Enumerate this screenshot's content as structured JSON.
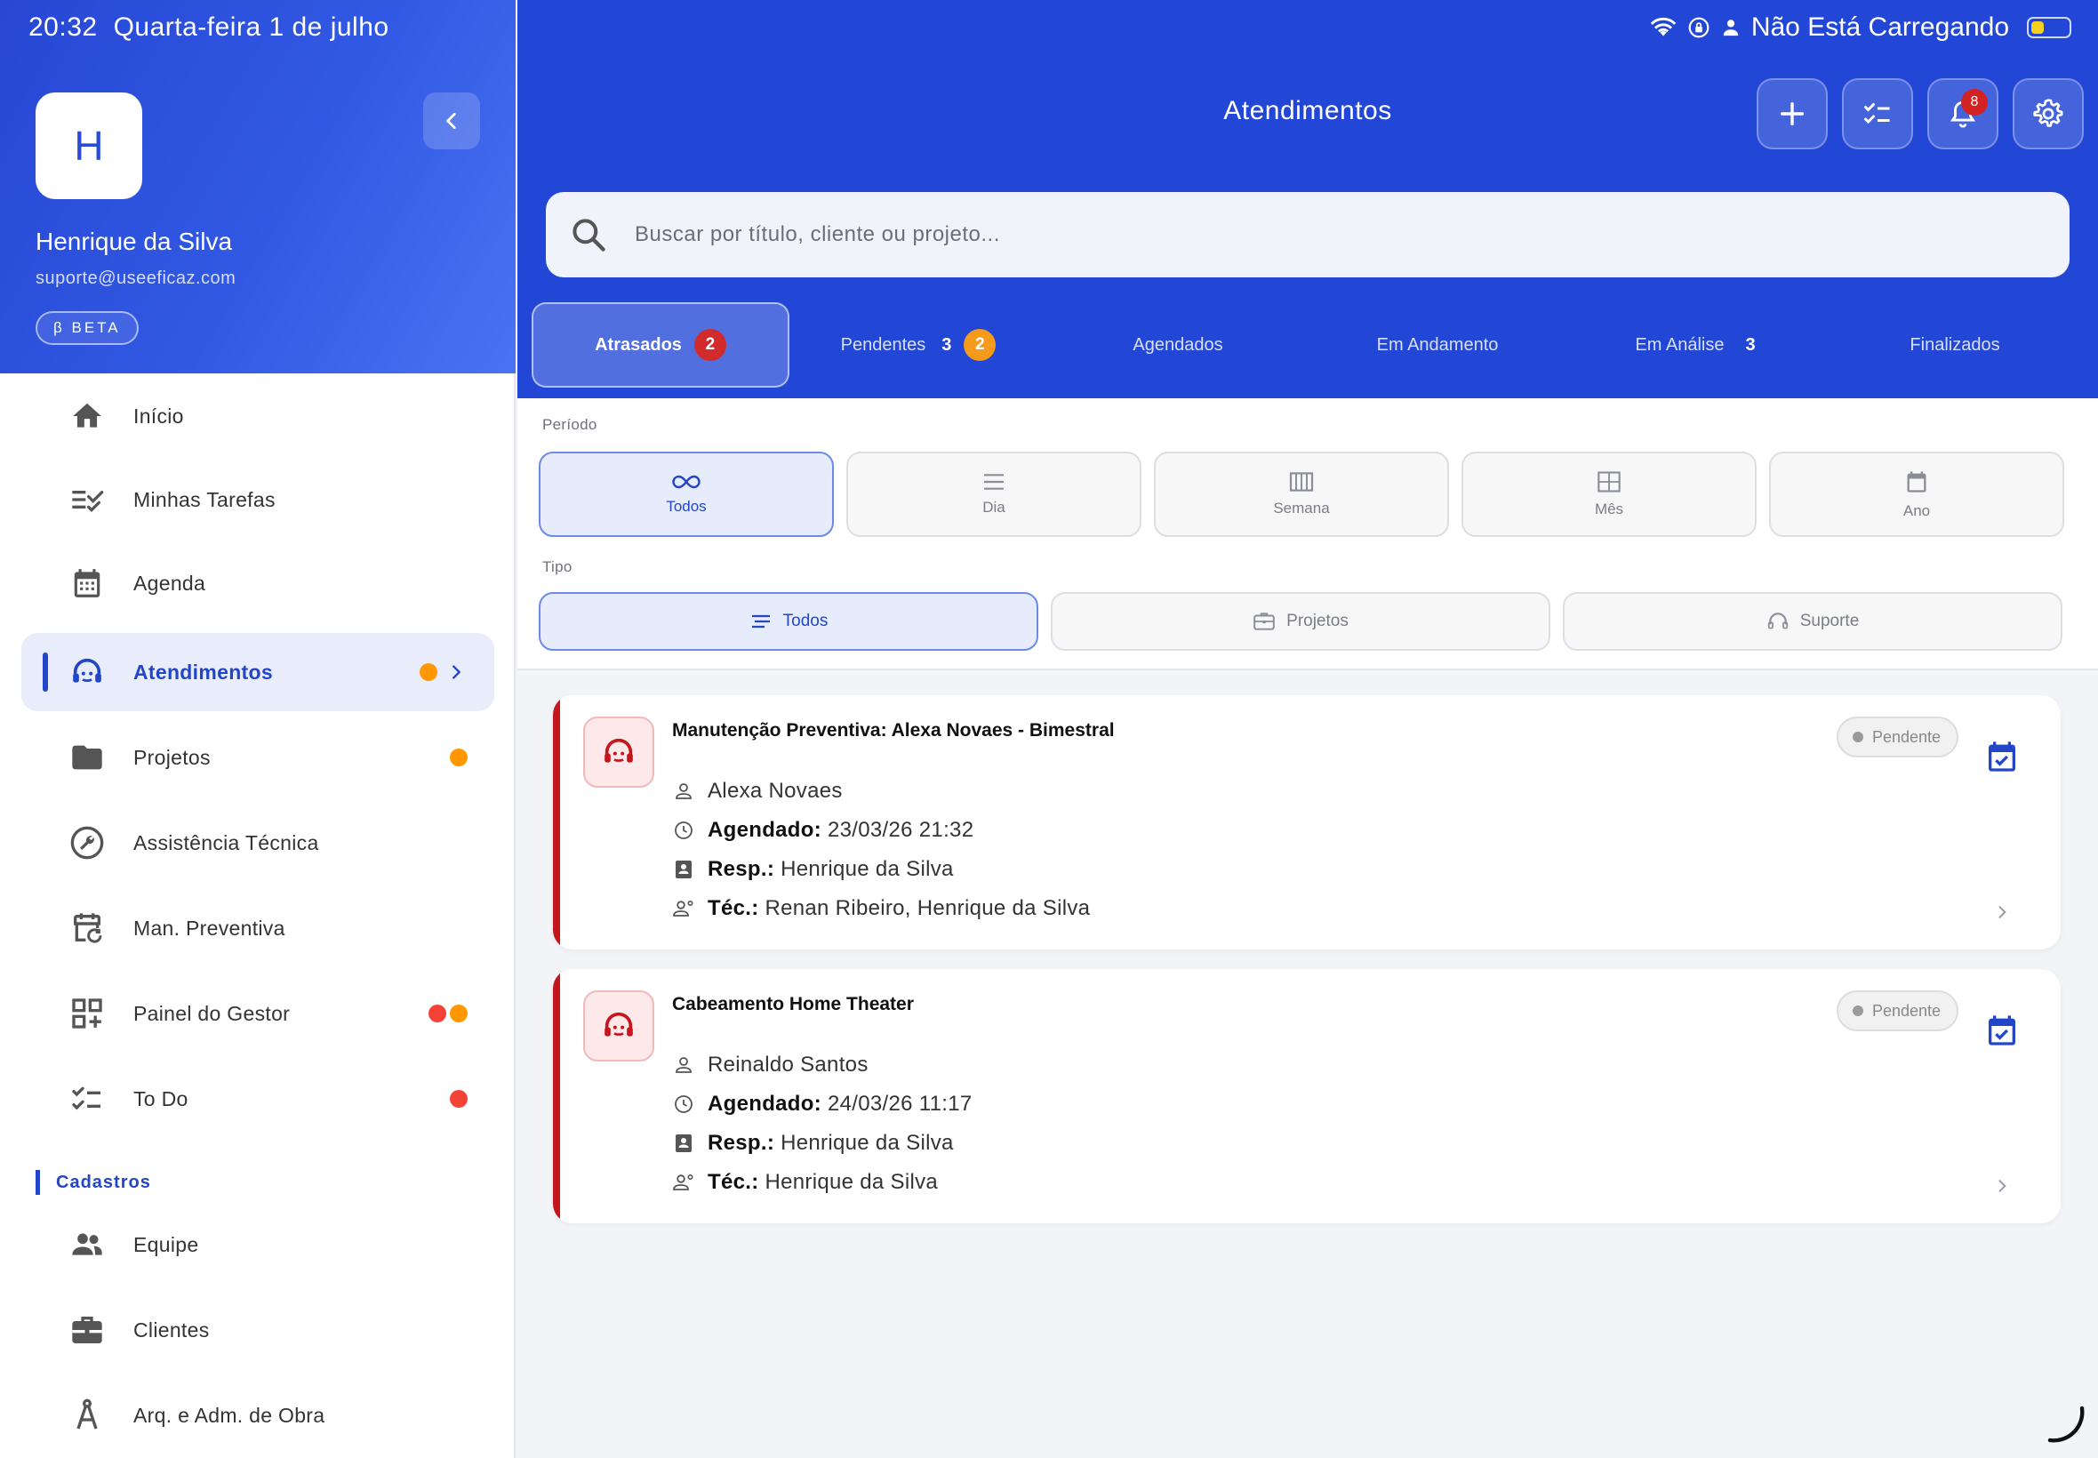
{
  "status_bar": {
    "time": "20:32",
    "date": "Quarta-feira 1 de julho",
    "charging": "Não Está Carregando"
  },
  "sidebar": {
    "avatar_letter": "H",
    "user_name": "Henrique da Silva",
    "user_email": "suporte@useeficaz.com",
    "beta_label": "β BETA",
    "items": [
      {
        "label": "Início",
        "icon": "home-icon"
      },
      {
        "label": "Minhas Tarefas",
        "icon": "tasks-check-icon"
      },
      {
        "label": "Agenda",
        "icon": "calendar-icon"
      },
      {
        "label": "Atendimentos",
        "icon": "headset-icon",
        "active": true
      },
      {
        "label": "Projetos",
        "icon": "folder-icon"
      },
      {
        "label": "Assistência Técnica",
        "icon": "wrench-icon"
      },
      {
        "label": "Man. Preventiva",
        "icon": "calendar-refresh-icon"
      },
      {
        "label": "Painel do Gestor",
        "icon": "dashboard-icon"
      },
      {
        "label": "To Do",
        "icon": "checklist-icon"
      }
    ],
    "section_title": "Cadastros",
    "section_items": [
      {
        "label": "Equipe",
        "icon": "people-icon"
      },
      {
        "label": "Clientes",
        "icon": "briefcase-icon"
      },
      {
        "label": "Arq. e Adm. de Obra",
        "icon": "compass-icon"
      }
    ],
    "indicator_colors": {
      "orange": "#ff9800",
      "red": "#f44336"
    }
  },
  "header": {
    "title": "Atendimentos",
    "notifications_count": "8",
    "search_placeholder": "Buscar por título, cliente ou projeto...",
    "tabs": [
      {
        "label": "Atrasados",
        "badge": "2",
        "active": true
      },
      {
        "label": "Pendentes",
        "count": "3",
        "badge": "2"
      },
      {
        "label": "Agendados"
      },
      {
        "label": "Em Andamento"
      },
      {
        "label": "Em Análise",
        "count": "3"
      },
      {
        "label": "Finalizados"
      }
    ]
  },
  "filters": {
    "period_label": "Período",
    "period_options": [
      "Todos",
      "Dia",
      "Semana",
      "Mês",
      "Ano"
    ],
    "period_selected": "Todos",
    "type_label": "Tipo",
    "type_options": [
      "Todos",
      "Projetos",
      "Suporte"
    ],
    "type_selected": "Todos"
  },
  "cards": [
    {
      "title": "Manutenção Preventiva: Alexa Novaes - Bimestral",
      "status": "Pendente",
      "client": "Alexa Novaes",
      "scheduled_label": "Agendado:",
      "scheduled": "23/03/26 21:32",
      "resp_label": "Resp.:",
      "resp": "Henrique da Silva",
      "tec_label": "Téc.:",
      "tec": "Renan Ribeiro, Henrique da Silva"
    },
    {
      "title": "Cabeamento Home Theater",
      "status": "Pendente",
      "client": "Reinaldo Santos",
      "scheduled_label": "Agendado:",
      "scheduled": "24/03/26 11:17",
      "resp_label": "Resp.:",
      "resp": "Henrique da Silva",
      "tec_label": "Téc.:",
      "tec": "Henrique da Silva"
    }
  ],
  "colors": {
    "primary": "#2247d6",
    "overdue": "#c4161c",
    "active_bg": "#e9edfb"
  }
}
